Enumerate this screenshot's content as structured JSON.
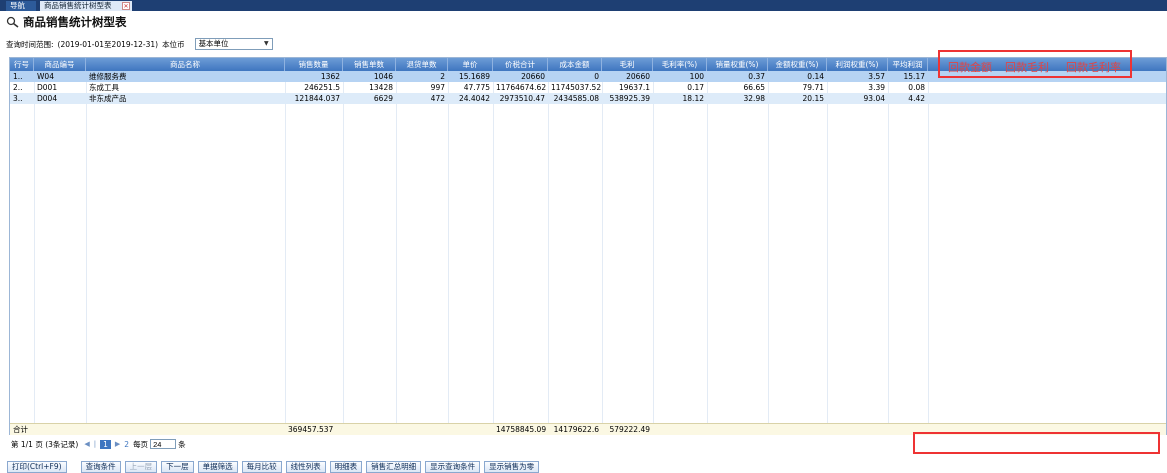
{
  "tabs": [
    {
      "label": "导航"
    },
    {
      "label": "商品销售统计树型表"
    }
  ],
  "page": {
    "title": "商品销售统计树型表",
    "filter_label": "查询时间范围:",
    "filter_range": "(2019-01-01至2019-12-31)",
    "currency_label": "本位币",
    "currency_value": "基本单位"
  },
  "grid": {
    "columns": [
      "行号",
      "商品编号",
      "商品名称",
      "销售数量",
      "销售单数",
      "退货单数",
      "单价",
      "价税合计",
      "成本金额",
      "毛利",
      "毛利率(%)",
      "销量权重(%)",
      "金额权重(%)",
      "利润权重(%)",
      "平均利润"
    ],
    "rows": [
      [
        "1..",
        "W04",
        "维修服务费",
        "1362",
        "1046",
        "2",
        "15.1689",
        "20660",
        "0",
        "20660",
        "100",
        "0.37",
        "0.14",
        "3.57",
        "15.17"
      ],
      [
        "2..",
        "D001",
        "东成工具",
        "246251.5",
        "13428",
        "997",
        "47.775",
        "11764674.62",
        "11745037.52",
        "19637.1",
        "0.17",
        "66.65",
        "79.71",
        "3.39",
        "0.08"
      ],
      [
        "3..",
        "D004",
        "非东成产品",
        "121844.037",
        "6629",
        "472",
        "24.4042",
        "2973510.47",
        "2434585.08",
        "538925.39",
        "18.12",
        "32.98",
        "20.15",
        "93.04",
        "4.42"
      ]
    ],
    "total": {
      "label": "合计",
      "qty": "369457.537",
      "tax_total": "14758845.09",
      "cost": "14179622.6",
      "profit": "579222.49"
    }
  },
  "annotations": [
    "回款金额",
    "回款毛利",
    "回款毛利率"
  ],
  "pager": {
    "page_info": "第 1/1 页 (3条记录)",
    "first": "◀",
    "prev": "|",
    "current": "1",
    "next": "▶",
    "page2": "2",
    "per_page_label": "每页",
    "per_page_value": "24",
    "per_page_unit": "条"
  },
  "toolbar": [
    "打印(Ctrl+F9)",
    "查询条件",
    "上一层",
    "下一层",
    "单据筛选",
    "每月比较",
    "线性列表",
    "明细表",
    "销售汇总明细",
    "显示查询条件",
    "显示销售为零"
  ],
  "colors": {
    "header": "#3f76c0",
    "tabbar": "#1e3f73",
    "annotation": "#e33333"
  }
}
